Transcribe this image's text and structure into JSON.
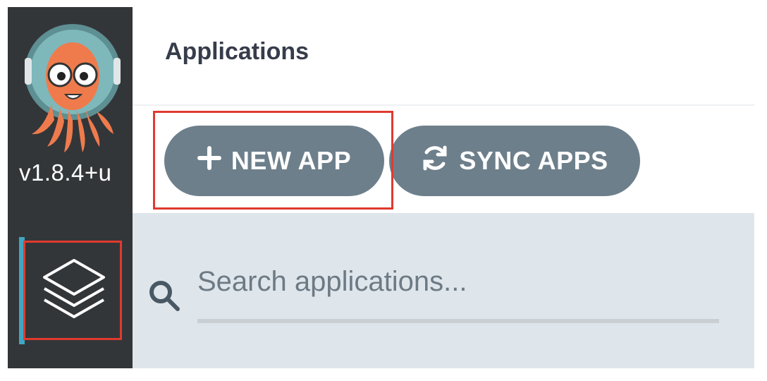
{
  "sidebar": {
    "version": "v1.8.4+u",
    "nav_items": [
      {
        "name": "applications",
        "icon": "layers-icon",
        "active": true
      }
    ],
    "logo": "argo-octopus-logo"
  },
  "header": {
    "title": "Applications"
  },
  "toolbar": {
    "new_app_label": "NEW APP",
    "new_app_icon": "plus-icon",
    "sync_apps_label": "SYNC APPS",
    "sync_apps_icon": "sync-icon"
  },
  "search": {
    "placeholder": "Search applications...",
    "value": "",
    "icon": "search-icon"
  },
  "colors": {
    "sidebar_bg": "#333639",
    "accent": "#3fa7c2",
    "button_bg": "#6d7f8b",
    "search_bg": "#dee6eb",
    "highlight": "#e03a2f"
  }
}
